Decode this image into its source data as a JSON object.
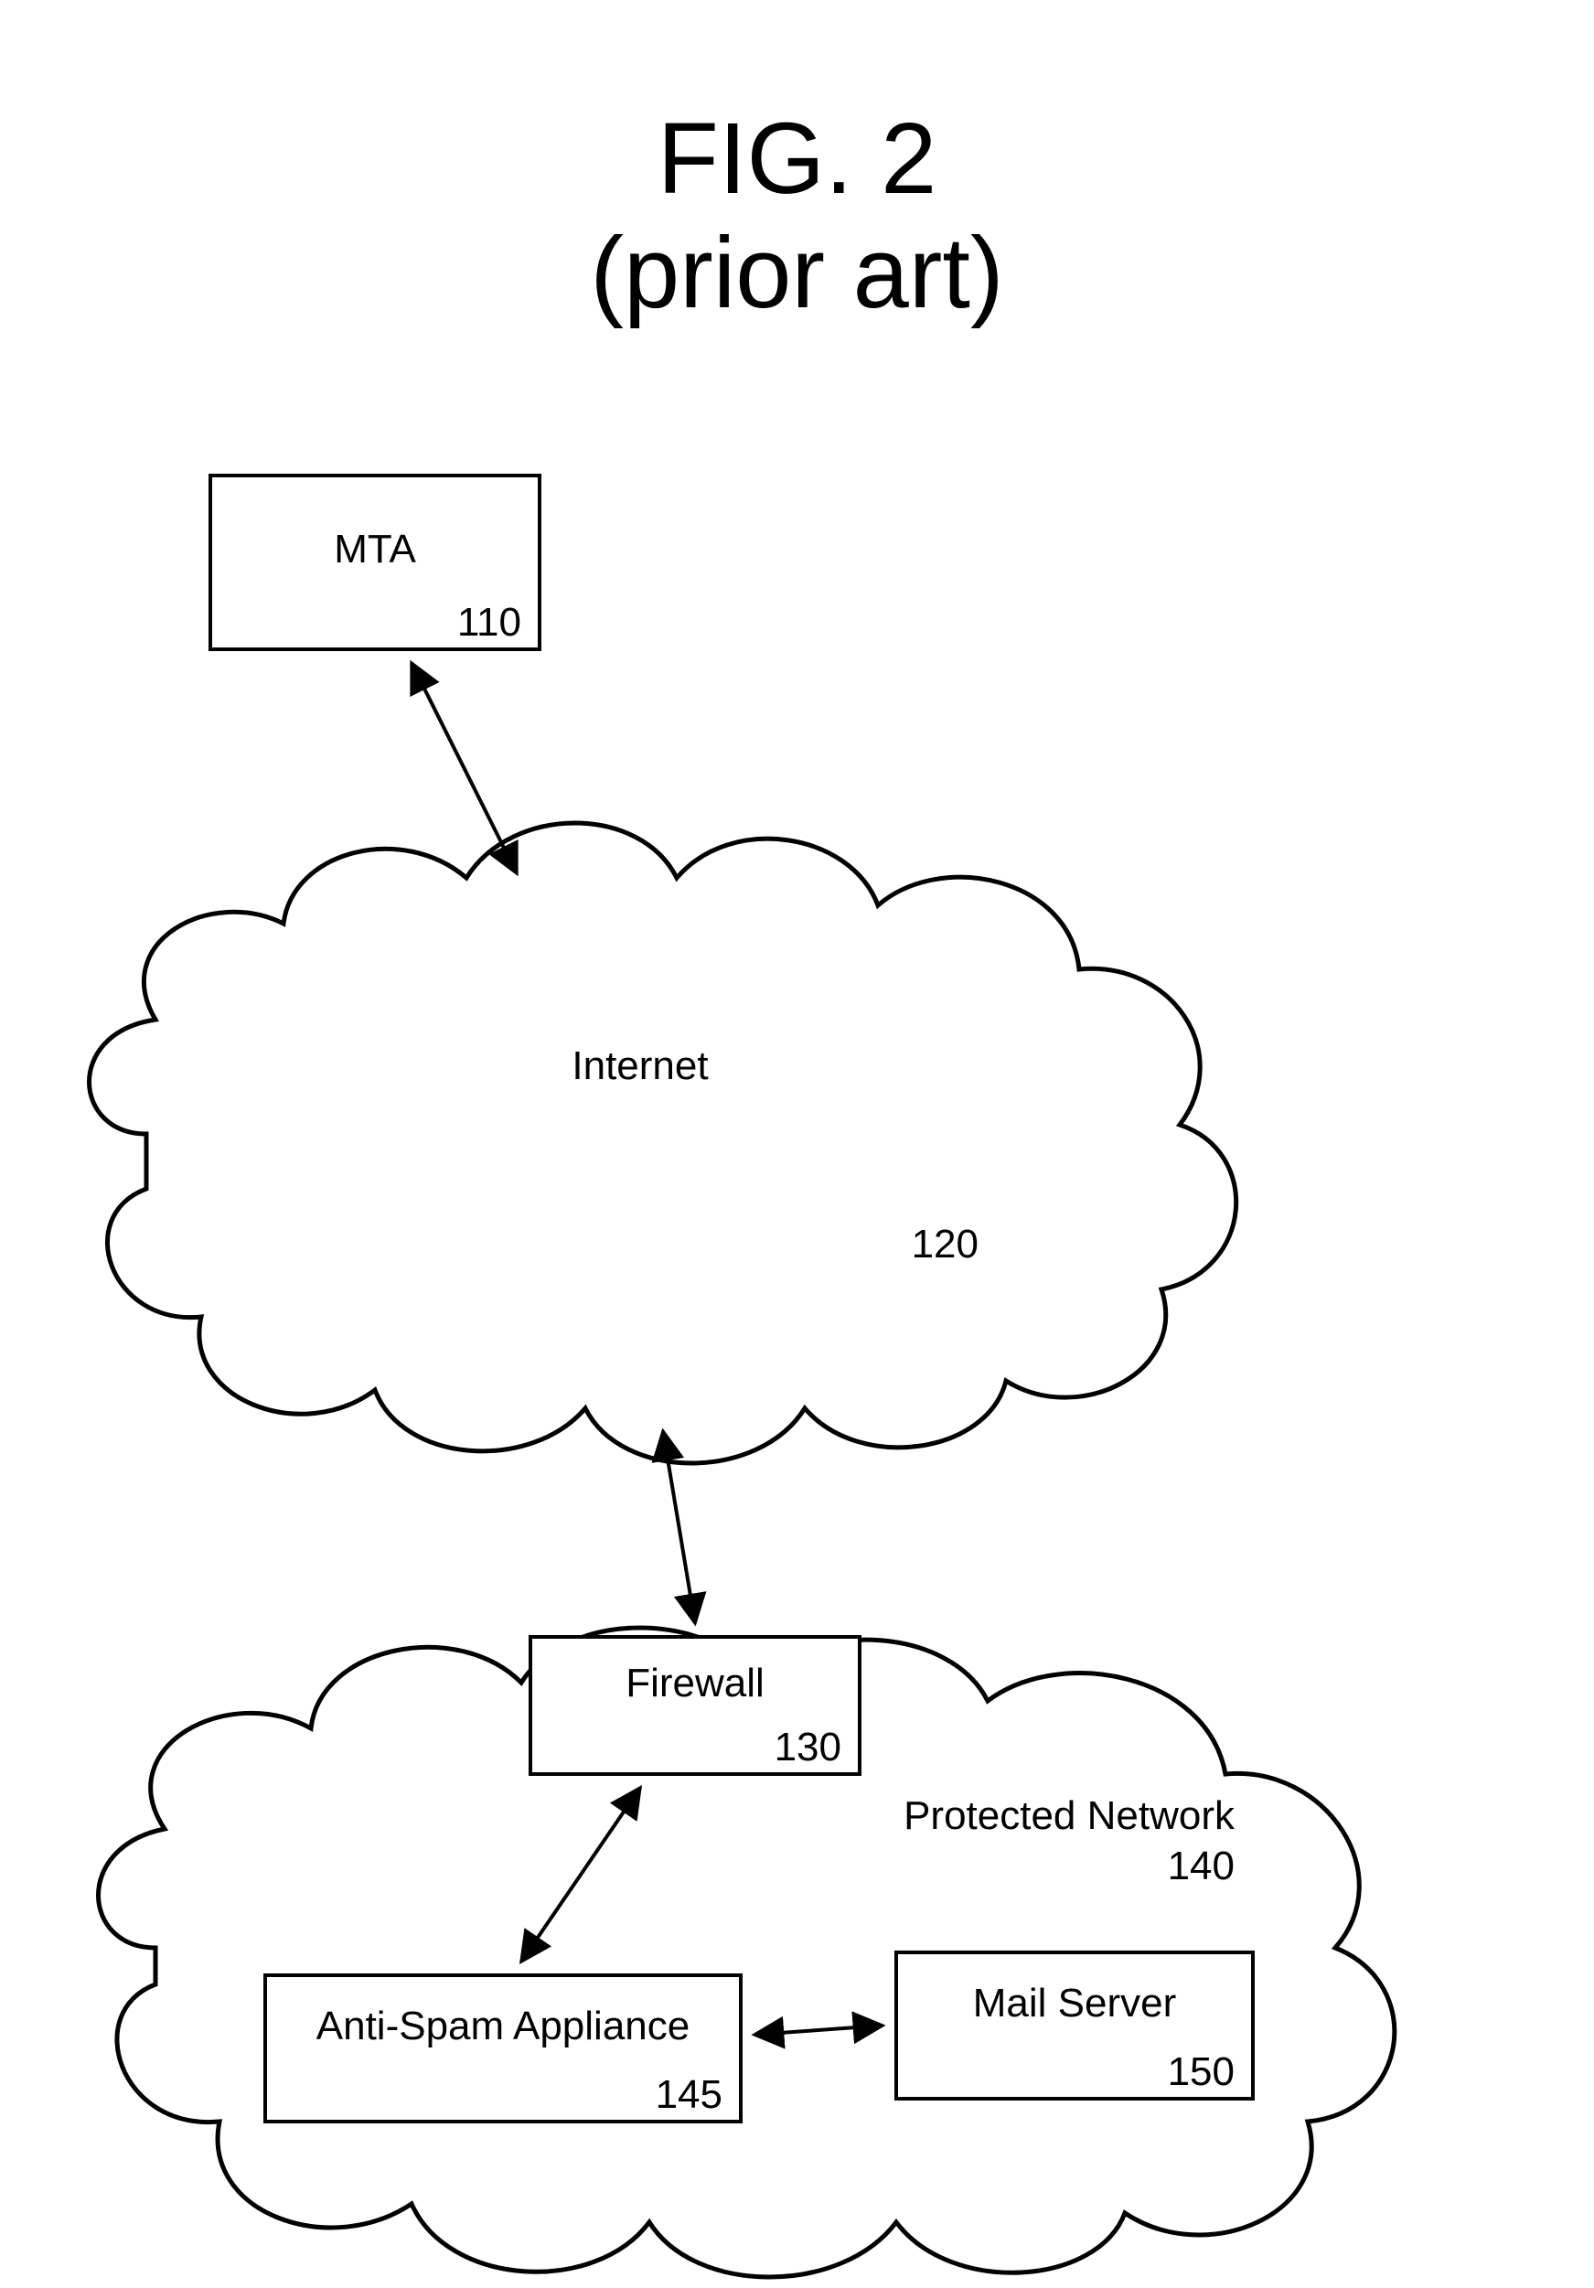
{
  "title": {
    "line1": "FIG. 2",
    "line2": "(prior art)"
  },
  "nodes": {
    "mta": {
      "label": "MTA",
      "ref": "110"
    },
    "internet": {
      "label": "Internet",
      "ref": "120"
    },
    "firewall": {
      "label": "Firewall",
      "ref": "130"
    },
    "network": {
      "label": "Protected Network",
      "ref": "140"
    },
    "antispam": {
      "label": "Anti-Spam Appliance",
      "ref": "145"
    },
    "mailserver": {
      "label": "Mail Server",
      "ref": "150"
    }
  }
}
